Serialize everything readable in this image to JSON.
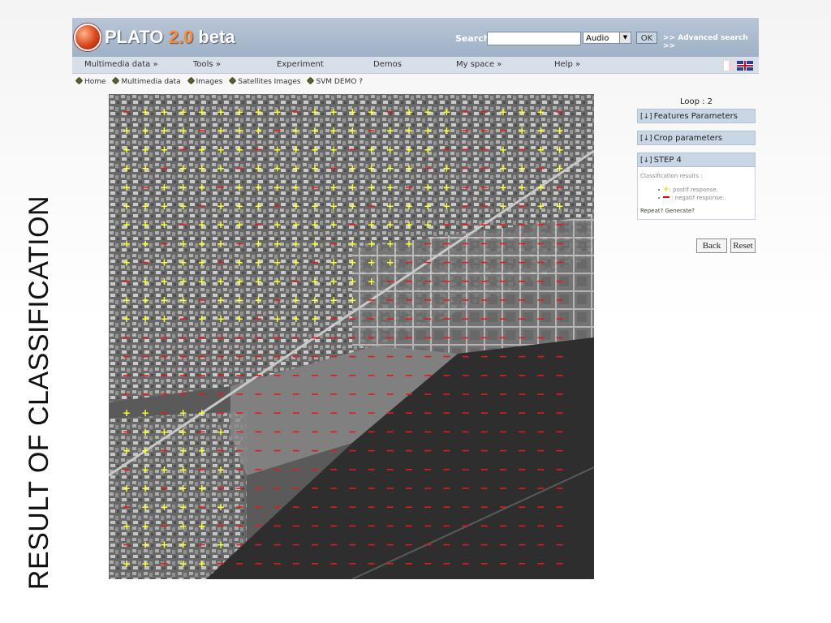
{
  "caption": "RESULT OF CLASSIFICATION",
  "logo": {
    "name": "PLATO",
    "version": "2.0",
    "tag": "beta"
  },
  "search": {
    "label": "Search",
    "value": "",
    "select_value": "Audio",
    "ok_label": "OK",
    "advanced_label": ">> Advanced search >>"
  },
  "menu": [
    "Multimedia data »",
    "Tools »",
    "Experiment",
    "Demos",
    "My space »",
    "Help »"
  ],
  "breadcrumb": [
    "Home",
    "Multimedia data",
    "Images",
    "Satellites Images",
    "SVM DEMO ?"
  ],
  "panel": {
    "loop_label": "Loop : 2",
    "features_label": "Features Parameters",
    "crop_label": "Crop parameters",
    "step_label": "STEP 4",
    "classification_title": "Classification results :",
    "positive_label": ": postif response.",
    "negative_label": ": negatif response.",
    "repeat_label": "Repeat? Generate?"
  },
  "buttons": {
    "back": "Back",
    "reset": "Reset"
  },
  "colors": {
    "positive": "#ffff3a",
    "negative": "#e81818",
    "header": "#a9b9cc"
  },
  "grid": {
    "rows": 26,
    "cols": 24
  }
}
